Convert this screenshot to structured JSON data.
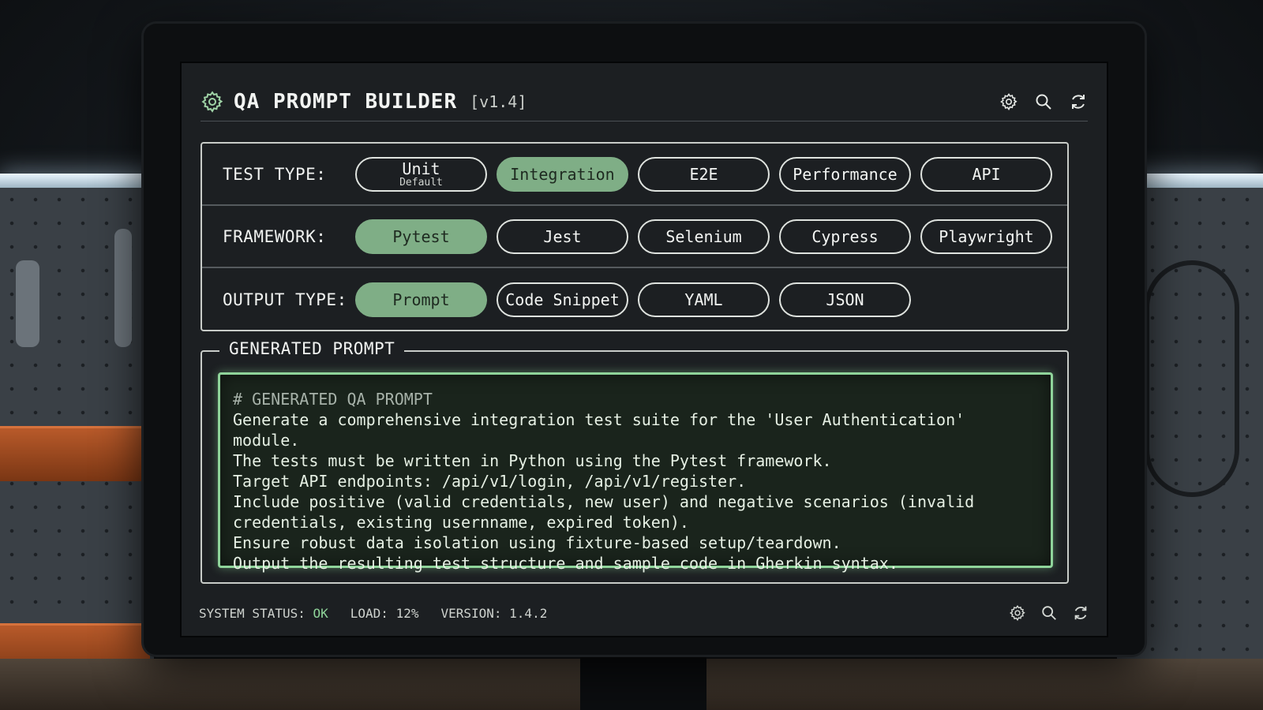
{
  "app": {
    "title": "QA PROMPT BUILDER",
    "version": "[v1.4]"
  },
  "header_icons": [
    "gear-icon",
    "search-icon",
    "refresh-icon"
  ],
  "rows": [
    {
      "label": "TEST TYPE:",
      "options": [
        {
          "label": "Unit",
          "sublabel": "Default",
          "active": false
        },
        {
          "label": "Integration",
          "active": true
        },
        {
          "label": "E2E",
          "active": false
        },
        {
          "label": "Performance",
          "active": false
        },
        {
          "label": "API",
          "active": false
        }
      ]
    },
    {
      "label": "FRAMEWORK:",
      "options": [
        {
          "label": "Pytest",
          "active": true
        },
        {
          "label": "Jest",
          "active": false
        },
        {
          "label": "Selenium",
          "active": false
        },
        {
          "label": "Cypress",
          "active": false
        },
        {
          "label": "Playwright",
          "active": false
        }
      ]
    },
    {
      "label": "OUTPUT TYPE:",
      "options": [
        {
          "label": "Prompt",
          "active": true
        },
        {
          "label": "Code Snippet",
          "active": false
        },
        {
          "label": "YAML",
          "active": false
        },
        {
          "label": "JSON",
          "active": false
        }
      ]
    }
  ],
  "generated": {
    "title": "GENERATED PROMPT",
    "comment": "# GENERATED QA PROMPT",
    "lines": [
      "Generate a comprehensive integration test suite for the 'User Authentication' module.",
      "The tests must be written in Python using the Pytest framework.",
      "Target API endpoints: /api/v1/login, /api/v1/register.",
      "Include positive (valid credentials, new user) and negative scenarios (invalid",
      "credentials, existing usernname, expired token).",
      "Ensure robust data isolation using fixture-based setup/teardown.",
      "Output the resulting test structure and sample code in Gherkin syntax."
    ]
  },
  "status": {
    "system_label": "SYSTEM STATUS: ",
    "system_value": "OK",
    "load": "LOAD: 12%",
    "version": "VERSION: 1.4.2"
  },
  "colors": {
    "accent": "#7fae86",
    "code_border": "#8fd49a",
    "background": "#1c1f22"
  }
}
